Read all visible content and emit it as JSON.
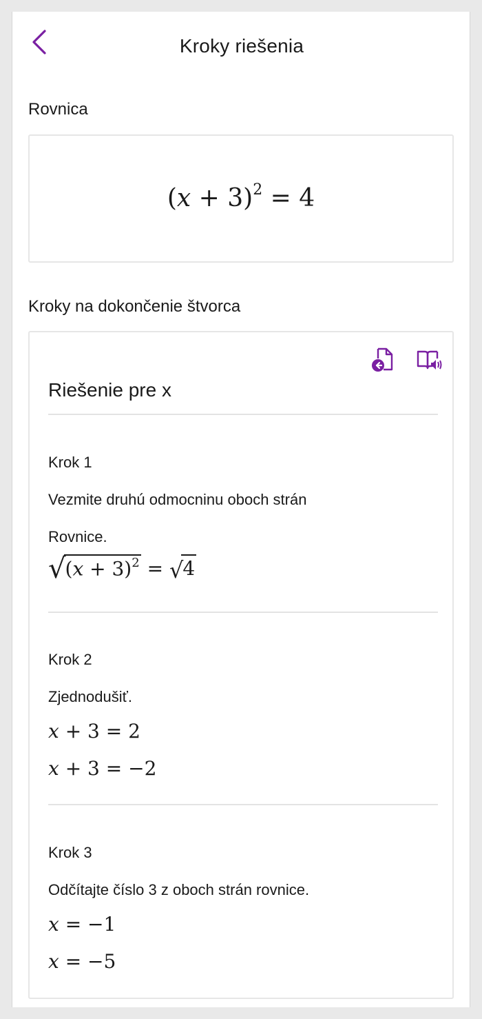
{
  "header": {
    "title": "Kroky riešenia",
    "back_icon": "chevron-left-icon"
  },
  "equation_section": {
    "label": "Rovnica",
    "lhs_open": "(",
    "lhs_var": "x",
    "lhs_rest": " + 3)",
    "lhs_exp": "2",
    "rhs": " = 4"
  },
  "steps_section": {
    "label": "Kroky na dokončenie štvorca",
    "tools": {
      "insert_icon": "insert-document-icon",
      "read_icon": "immersive-reader-icon"
    },
    "title": "Riešenie pre x",
    "steps": [
      {
        "label": "Krok 1",
        "text_line1": "Vezmite druhú odmocninu oboch strán",
        "text_line2": "Rovnice.",
        "math": {
          "inner_open": "(",
          "inner_var": "x",
          "inner_rest": " + 3)",
          "inner_exp": "2",
          "rhs_eq": " = ",
          "rhs_val": "4"
        }
      },
      {
        "label": "Krok 2",
        "text": "Zjednodušiť.",
        "math_lines": [
          {
            "var": "x",
            "rest": " + 3 = 2"
          },
          {
            "var": "x",
            "rest": " + 3 = −2"
          }
        ]
      },
      {
        "label": "Krok 3",
        "text": "Odčítajte číslo 3 z oboch strán rovnice.",
        "math_lines": [
          {
            "var": "x",
            "rest": " = −1"
          },
          {
            "var": "x",
            "rest": " = −5"
          }
        ]
      }
    ]
  },
  "colors": {
    "accent": "#7a1fa2",
    "text": "#1a1a1a",
    "border": "#e6e6e6"
  }
}
